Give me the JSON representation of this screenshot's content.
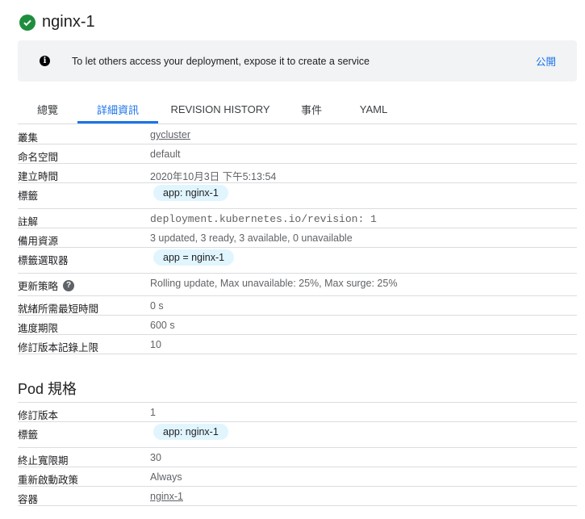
{
  "title": "nginx-1",
  "banner": {
    "message": "To let others access your deployment, expose it to create a service",
    "action": "公開"
  },
  "tabs": [
    "總覽",
    "詳細資訊",
    "REVISION HISTORY",
    "事件",
    "YAML"
  ],
  "details": {
    "cluster": {
      "k": "叢集",
      "v": "gycluster"
    },
    "namespace": {
      "k": "命名空間",
      "v": "default"
    },
    "created": {
      "k": "建立時間",
      "v": "2020年10月3日 下午5:13:54"
    },
    "labels": {
      "k": "標籤",
      "v": "app: nginx-1"
    },
    "annotations": {
      "k": "註解",
      "v": "deployment.kubernetes.io/revision: 1"
    },
    "replicas": {
      "k": "備用資源",
      "v": "3 updated, 3 ready, 3 available, 0 unavailable"
    },
    "selector": {
      "k": "標籤選取器",
      "v": "app = nginx-1"
    },
    "strategy": {
      "k": "更新策略",
      "v": "Rolling update, Max unavailable: 25%, Max surge: 25%"
    },
    "min_ready": {
      "k": "就緒所需最短時間",
      "v": "0 s"
    },
    "progress": {
      "k": "進度期限",
      "v": "600 s"
    },
    "revision_limit": {
      "k": "修訂版本記錄上限",
      "v": "10"
    }
  },
  "pod": {
    "heading": "Pod 規格",
    "revision": {
      "k": "修訂版本",
      "v": "1"
    },
    "labels": {
      "k": "標籤",
      "v": "app: nginx-1"
    },
    "grace": {
      "k": "終止寬限期",
      "v": "30"
    },
    "restart": {
      "k": "重新啟動政策",
      "v": "Always"
    },
    "containers": {
      "k": "容器",
      "v": "nginx-1"
    }
  }
}
